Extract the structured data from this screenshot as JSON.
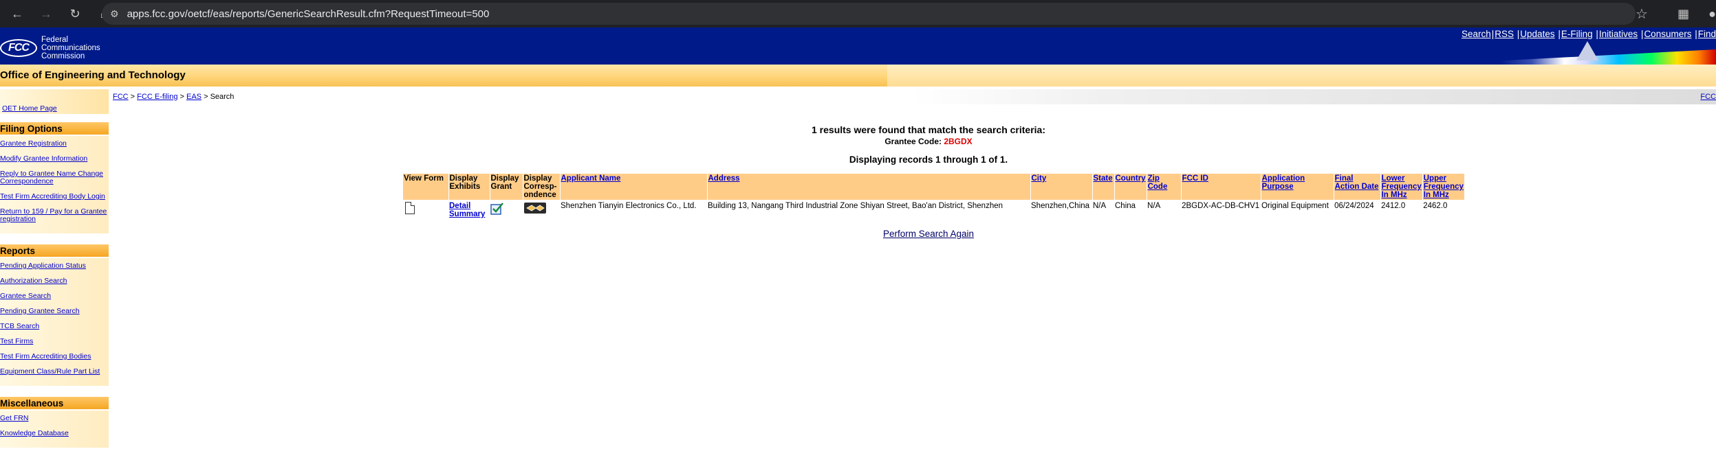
{
  "browser": {
    "url": "apps.fcc.gov/oetcf/eas/reports/GenericSearchResult.cfm?RequestTimeout=500"
  },
  "header": {
    "logo_text": "FCC",
    "agency_lines": [
      "Federal",
      "Communications",
      "Commission"
    ],
    "links": [
      "Search",
      "RSS",
      "Updates",
      "E-Filing",
      "Initiatives",
      "Consumers",
      "Find"
    ]
  },
  "office_title": "Office of Engineering and Technology",
  "breadcrumb": {
    "items": [
      "FCC",
      "FCC E-filing",
      "EAS"
    ],
    "current": "Search",
    "right_link": "FCC"
  },
  "sidebar": {
    "home_link": "OET Home Page",
    "sections": [
      {
        "title": "Filing Options",
        "items": [
          "Grantee Registration",
          "Modify Grantee Information",
          "Reply to Grantee Name Change Correspondence",
          "Test Firm Accrediting Body Login",
          "Return to 159 / Pay for a Grantee registration"
        ]
      },
      {
        "title": "Reports",
        "items": [
          "Pending Application Status",
          "Authorization Search",
          "Grantee Search",
          "Pending Grantee Search",
          "TCB Search",
          "Test Firms",
          "Test Firm Accrediting Bodies",
          "Equipment Class/Rule Part List"
        ]
      },
      {
        "title": "Miscellaneous",
        "items": [
          "Get FRN",
          "Knowledge Database"
        ]
      }
    ]
  },
  "results": {
    "found_text": "1 results were found that match the search criteria:",
    "grantee_label": "Grantee Code:",
    "grantee_code": "2BGDX",
    "displaying_text": "Displaying records 1 through 1 of 1."
  },
  "table": {
    "headers": {
      "view_form": "View Form",
      "display_exhibits": "Display Exhibits",
      "display_grant": "Display Grant",
      "display_corr": "Display Corresp-ondence",
      "applicant": "Applicant Name",
      "address": "Address",
      "city": "City",
      "state": "State",
      "country": "Country",
      "zip": "Zip Code",
      "fcc_id": "FCC ID",
      "purpose": "Application Purpose",
      "final_action": "Final Action Date",
      "lower_freq": "Lower Frequency In MHz",
      "upper_freq": "Upper Frequency In MHz"
    },
    "row": {
      "exhibits_link": "Detail Summary",
      "applicant": "Shenzhen Tianyin Electronics Co., Ltd.",
      "address": "Building 13, Nangang Third Industrial Zone Shiyan Street, Bao'an District, Shenzhen",
      "city": "Shenzhen,",
      "state": "N/A",
      "country": "China",
      "country2": "China",
      "zip": "N/A",
      "fcc_id": "2BGDX-AC-DB-CHV1",
      "purpose": "Original Equipment",
      "final_action": "06/24/2024",
      "lower_freq": "2412.0",
      "upper_freq": "2462.0"
    }
  },
  "search_again": "Perform Search Again"
}
